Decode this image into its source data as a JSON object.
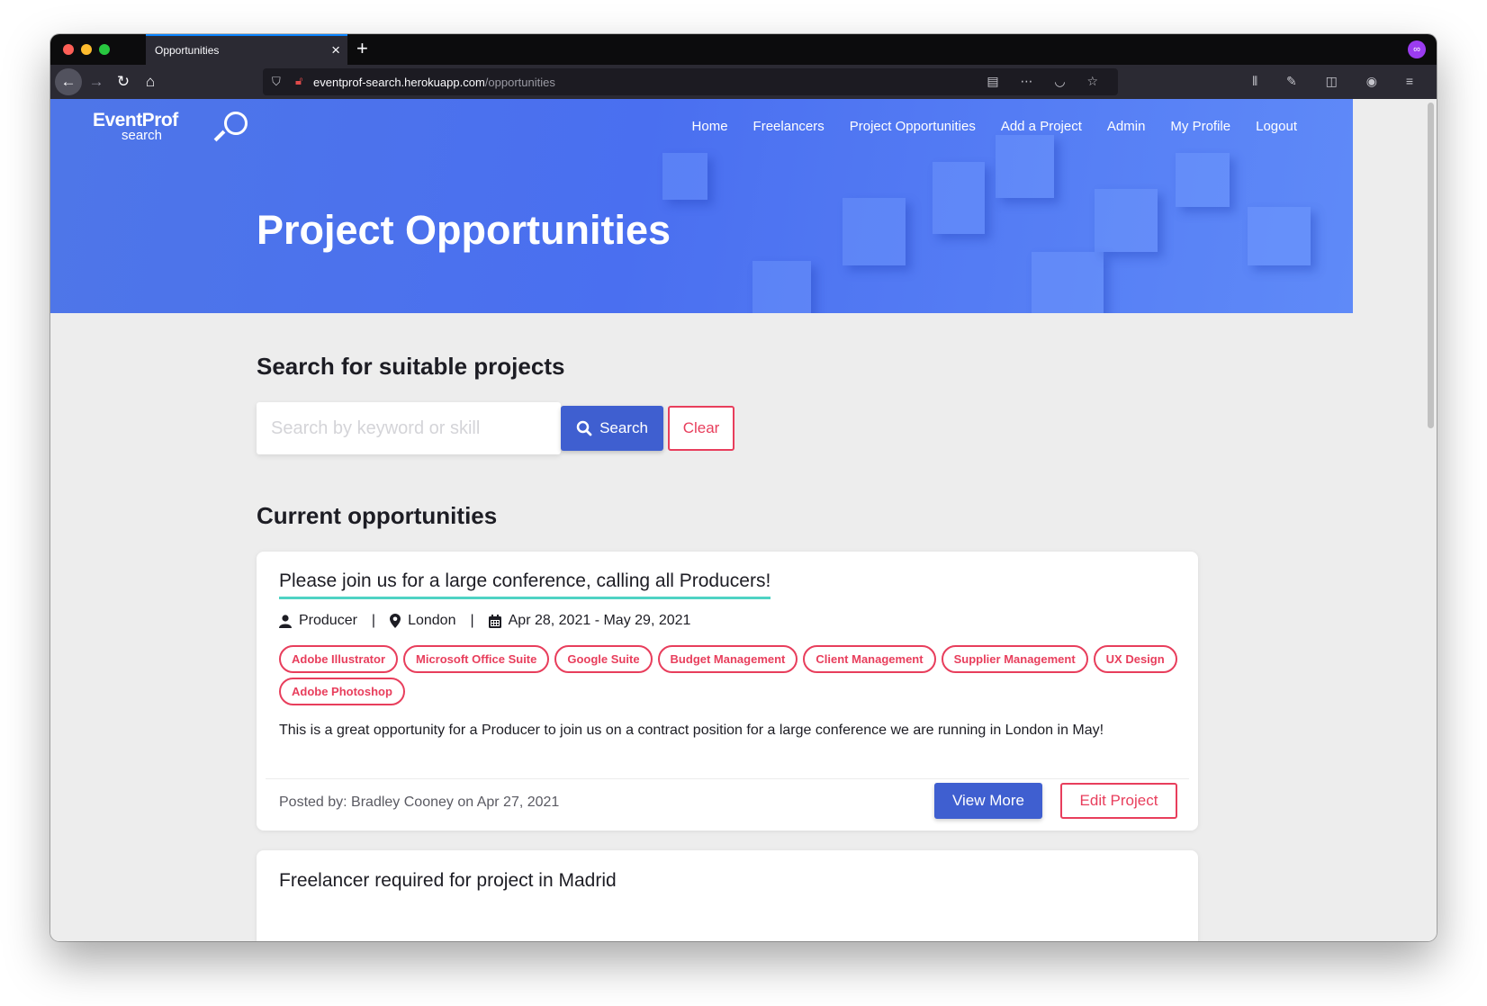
{
  "browser": {
    "tab_title": "Opportunities",
    "url_host": "eventprof-search.herokuapp.com",
    "url_path": "/opportunities"
  },
  "header": {
    "logo_main": "EventProf",
    "logo_sub": "search",
    "menu": [
      {
        "label": "Home"
      },
      {
        "label": "Freelancers"
      },
      {
        "label": "Project Opportunities"
      },
      {
        "label": "Add a Project"
      },
      {
        "label": "Admin"
      },
      {
        "label": "My Profile"
      },
      {
        "label": "Logout"
      }
    ],
    "title": "Project Opportunities"
  },
  "search": {
    "heading": "Search for suitable projects",
    "placeholder": "Search by keyword or skill",
    "value": "",
    "search_label": "Search",
    "clear_label": "Clear"
  },
  "opportunities": {
    "heading": "Current opportunities",
    "items": [
      {
        "title": "Please join us for a large conference, calling all Producers!",
        "role": "Producer",
        "location": "London",
        "dates": "Apr 28, 2021 - May 29, 2021",
        "skills": [
          "Adobe Illustrator",
          "Microsoft Office Suite",
          "Google Suite",
          "Budget Management",
          "Client Management",
          "Supplier Management",
          "UX Design",
          "Adobe Photoshop"
        ],
        "description": "This is a great opportunity for a Producer to join us on a contract position for a large conference we are running in London in May!",
        "posted": "Posted by: Bradley Cooney on Apr 27, 2021",
        "view_label": "View More",
        "edit_label": "Edit Project"
      },
      {
        "title": "Freelancer required for project in Madrid"
      }
    ]
  },
  "colors": {
    "primary": "#3f5fd0",
    "accent": "#e83e5c",
    "underline": "#4fd3c4",
    "hero": "#4e76e8"
  }
}
